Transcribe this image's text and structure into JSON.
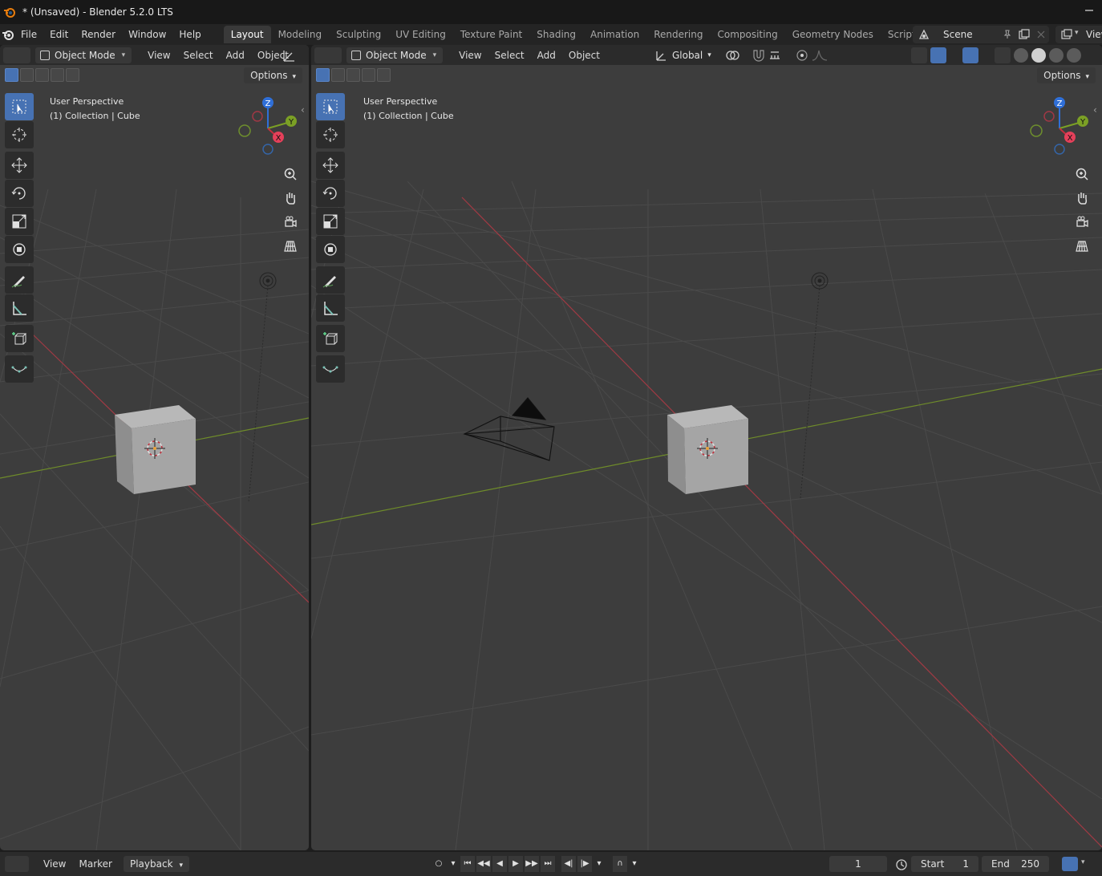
{
  "window": {
    "title": "* (Unsaved) - Blender 5.2.0 LTS"
  },
  "menus": [
    "File",
    "Edit",
    "Render",
    "Window",
    "Help"
  ],
  "workspaces": [
    "Layout",
    "Modeling",
    "Sculpting",
    "UV Editing",
    "Texture Paint",
    "Shading",
    "Animation",
    "Rendering",
    "Compositing",
    "Geometry Nodes",
    "Scripting"
  ],
  "active_workspace": "Layout",
  "scene": {
    "name": "Scene"
  },
  "view_layer": {
    "label": "View"
  },
  "viewport_left": {
    "mode": "Object Mode",
    "menus": [
      "View",
      "Select",
      "Add",
      "Object"
    ],
    "options": "Options",
    "info_line1": "User Perspective",
    "info_line2": "(1) Collection | Cube"
  },
  "viewport_right": {
    "mode": "Object Mode",
    "menus": [
      "View",
      "Select",
      "Add",
      "Object"
    ],
    "transform_orientation": "Global",
    "options": "Options",
    "info_line1": "User Perspective",
    "info_line2": "(1) Collection | Cube"
  },
  "gizmo_axes": {
    "x": "X",
    "y": "Y",
    "z": "Z"
  },
  "tools": [
    "select-box",
    "cursor",
    "move",
    "rotate",
    "scale",
    "transform",
    "annotate",
    "measure",
    "add-cube",
    "extrude"
  ],
  "timeline": {
    "menus": [
      "View",
      "Marker"
    ],
    "playback": "Playback",
    "current_frame": "1",
    "start_label": "Start",
    "start": "1",
    "end_label": "End",
    "end": "250"
  },
  "colors": {
    "accent": "#4772b3",
    "x_axis": "#c2303f",
    "y_axis": "#7ba025",
    "z_axis": "#2f6fd8",
    "viewport_bg": "#3d3d3d"
  }
}
